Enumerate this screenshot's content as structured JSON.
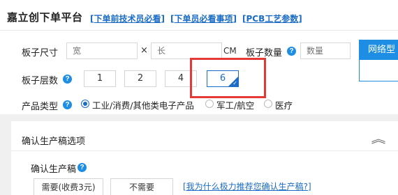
{
  "header": {
    "brand": "嘉立创下单平台",
    "links": [
      {
        "text": "下单前技术员必看"
      },
      {
        "text": "下单员必看事项"
      },
      {
        "text": "PCB工艺参数"
      }
    ]
  },
  "board_size": {
    "label": "板子尺寸",
    "width_placeholder": "宽",
    "times": "×",
    "length_placeholder": "长",
    "unit": "CM"
  },
  "board_quantity": {
    "label": "板子数量",
    "placeholder": "数量"
  },
  "layers": {
    "label": "板子层数",
    "options": [
      "1",
      "2",
      "4",
      "6"
    ],
    "selected": "6"
  },
  "product_type": {
    "label": "产品类型",
    "options": [
      "工业/消费/其他类电子产品",
      "军工/航空",
      "医疗"
    ],
    "selected": "工业/消费/其他类电子产品"
  },
  "side_panel": {
    "title": "网络型"
  },
  "production_draft": {
    "section_title": "确认生产稿选项",
    "label": "确认生产稿",
    "options": [
      "需要(收费3元)",
      "不需要"
    ],
    "why_link": "[我为什么极力推荐您确认生产稿?]"
  },
  "colors": {
    "accent": "#1a6cc4",
    "help": "#1e8ee4",
    "highlight": "#e53935"
  }
}
